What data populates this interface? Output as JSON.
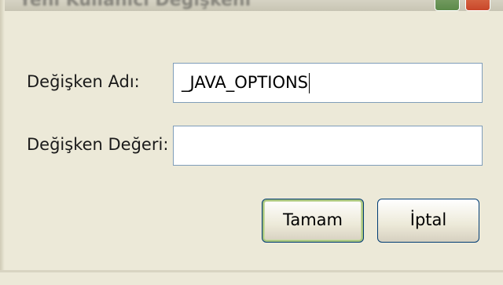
{
  "window": {
    "title": "Yeni Kullanıcı Değişkeni"
  },
  "form": {
    "name_label": "Değişken Adı:",
    "name_value": "_JAVA_OPTIONS",
    "value_label": "Değişken Değeri:",
    "value_value": ""
  },
  "buttons": {
    "ok_label": "Tamam",
    "cancel_label": "İptal"
  },
  "titlebar_buttons": [
    "help-button",
    "close-button"
  ]
}
